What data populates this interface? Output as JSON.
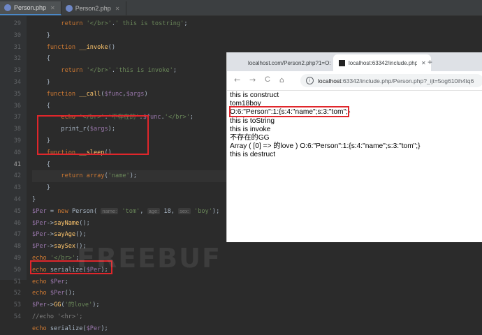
{
  "editor": {
    "tabs": [
      {
        "label": "Person.php"
      },
      {
        "label": "Person2.php"
      }
    ],
    "line_numbers": [
      "29",
      "30",
      "31",
      "32",
      "33",
      "34",
      "35",
      "36",
      "37",
      "38",
      "39",
      "40",
      "41",
      "42",
      "43",
      "44",
      "45",
      "46",
      "47",
      "48",
      "49",
      "50",
      "51",
      "52",
      "53",
      "54"
    ],
    "lines": [
      {
        "t": [
          [
            "k",
            "        return "
          ],
          [
            "s",
            "'</br>'"
          ],
          [
            "p",
            "."
          ],
          [
            "s",
            "' this is tostring'"
          ],
          [
            "p",
            ";"
          ]
        ]
      },
      {
        "t": [
          [
            "p",
            "    }"
          ]
        ]
      },
      {
        "t": [
          [
            "k",
            "    function "
          ],
          [
            "f",
            "__invoke"
          ],
          [
            "p",
            "()"
          ]
        ]
      },
      {
        "t": [
          [
            "p",
            "    {"
          ]
        ]
      },
      {
        "t": [
          [
            "k",
            "        return "
          ],
          [
            "s",
            "'</br>'"
          ],
          [
            "p",
            "."
          ],
          [
            "s",
            "'this is invoke'"
          ],
          [
            "p",
            ";"
          ]
        ]
      },
      {
        "t": [
          [
            "p",
            "    }"
          ]
        ]
      },
      {
        "t": [
          [
            "k",
            "    function "
          ],
          [
            "f",
            "__call"
          ],
          [
            "p",
            "("
          ],
          [
            "v",
            "$func"
          ],
          [
            "p",
            ","
          ],
          [
            "v",
            "$args"
          ],
          [
            "p",
            ")"
          ]
        ]
      },
      {
        "t": [
          [
            "p",
            "    {"
          ]
        ]
      },
      {
        "t": [
          [
            "k",
            "        echo "
          ],
          [
            "s",
            "'</br>'"
          ],
          [
            "p",
            "."
          ],
          [
            "s",
            "'不存在的'"
          ],
          [
            "p",
            "."
          ],
          [
            "v",
            "$func"
          ],
          [
            "p",
            "."
          ],
          [
            "s",
            "'</br>'"
          ],
          [
            "p",
            ";"
          ]
        ]
      },
      {
        "t": [
          [
            "p",
            "        print_r("
          ],
          [
            "v",
            "$args"
          ],
          [
            "p",
            ");"
          ]
        ]
      },
      {
        "t": [
          [
            "p",
            "    }"
          ]
        ]
      },
      {
        "t": [
          [
            "k",
            "    function "
          ],
          [
            "f",
            "__sleep"
          ],
          [
            "p",
            "()"
          ]
        ]
      },
      {
        "t": [
          [
            "p",
            "    {"
          ]
        ]
      },
      {
        "t": [
          [
            "k",
            "        return "
          ],
          [
            "k",
            "array"
          ],
          [
            "p",
            "("
          ],
          [
            "s",
            "'name'"
          ],
          [
            "p",
            ");"
          ]
        ],
        "hl": true
      },
      {
        "t": [
          [
            "p",
            "    }"
          ]
        ]
      },
      {
        "t": [
          [
            "p",
            "}"
          ]
        ]
      },
      {
        "t": [
          [
            "v",
            "$Per"
          ],
          [
            "p",
            " = "
          ],
          [
            "k",
            "new "
          ],
          [
            "p",
            "Person( "
          ],
          [
            "h",
            "name:"
          ],
          [
            "s",
            " 'tom'"
          ],
          [
            "p",
            ", "
          ],
          [
            "h",
            "age:"
          ],
          [
            "p",
            " 18, "
          ],
          [
            "h",
            "sex:"
          ],
          [
            "s",
            " 'boy'"
          ],
          [
            "p",
            ");"
          ]
        ]
      },
      {
        "t": [
          [
            "v",
            "$Per"
          ],
          [
            "p",
            "->"
          ],
          [
            "f",
            "sayName"
          ],
          [
            "p",
            "();"
          ]
        ]
      },
      {
        "t": [
          [
            "v",
            "$Per"
          ],
          [
            "p",
            "->"
          ],
          [
            "f",
            "sayAge"
          ],
          [
            "p",
            "();"
          ]
        ]
      },
      {
        "t": [
          [
            "v",
            "$Per"
          ],
          [
            "p",
            "->"
          ],
          [
            "f",
            "saySex"
          ],
          [
            "p",
            "();"
          ]
        ]
      },
      {
        "t": [
          [
            "k",
            "echo "
          ],
          [
            "s",
            "'</br>'"
          ],
          [
            "p",
            ";"
          ]
        ]
      },
      {
        "t": [
          [
            "k",
            "echo "
          ],
          [
            "p",
            "serialize("
          ],
          [
            "v",
            "$Per"
          ],
          [
            "p",
            ");"
          ]
        ]
      },
      {
        "t": [
          [
            "k",
            "echo "
          ],
          [
            "v",
            "$Per"
          ],
          [
            "p",
            ";"
          ]
        ]
      },
      {
        "t": [
          [
            "k",
            "echo "
          ],
          [
            "v",
            "$Per"
          ],
          [
            "p",
            "();"
          ]
        ]
      },
      {
        "t": [
          [
            "v",
            "$Per"
          ],
          [
            "p",
            "->"
          ],
          [
            "f",
            "GG"
          ],
          [
            "p",
            "("
          ],
          [
            "s",
            "'的love'"
          ],
          [
            "p",
            ");"
          ]
        ]
      },
      {
        "t": [
          [
            "c",
            "//echo '<hr>';"
          ]
        ]
      },
      {
        "t": [
          [
            "k",
            "echo "
          ],
          [
            "p",
            "serialize("
          ],
          [
            "v",
            "$Per"
          ],
          [
            "p",
            ");"
          ]
        ]
      }
    ]
  },
  "browser": {
    "tabs": [
      {
        "label": "localhost.com/Person2.php?1=O:"
      },
      {
        "label": "localhost:63342/include.php/"
      }
    ],
    "new_tab": "+",
    "nav": {
      "back": "←",
      "forward": "→",
      "reload": "C",
      "home": "⌂"
    },
    "url_host": "localhost",
    "url_rest": ":63342/include.php/Person.php?_ijt=5og610ih4tq6",
    "output_lines": [
      "this is construct",
      "tom18boy",
      "O:6:\"Person\":1:{s:4:\"name\";s:3:\"tom\";}",
      "this is toString",
      "this is invoke",
      "不存在的GG",
      "Array ( [0] => 的love ) O:6:\"Person\":1:{s:4:\"name\";s:3:\"tom\";}",
      "this is destruct"
    ]
  },
  "colors": {
    "keyword": "#cc7832",
    "string": "#6a8759",
    "function": "#ffc66d",
    "variable": "#9876aa",
    "highlight_box": "#e0262b"
  }
}
